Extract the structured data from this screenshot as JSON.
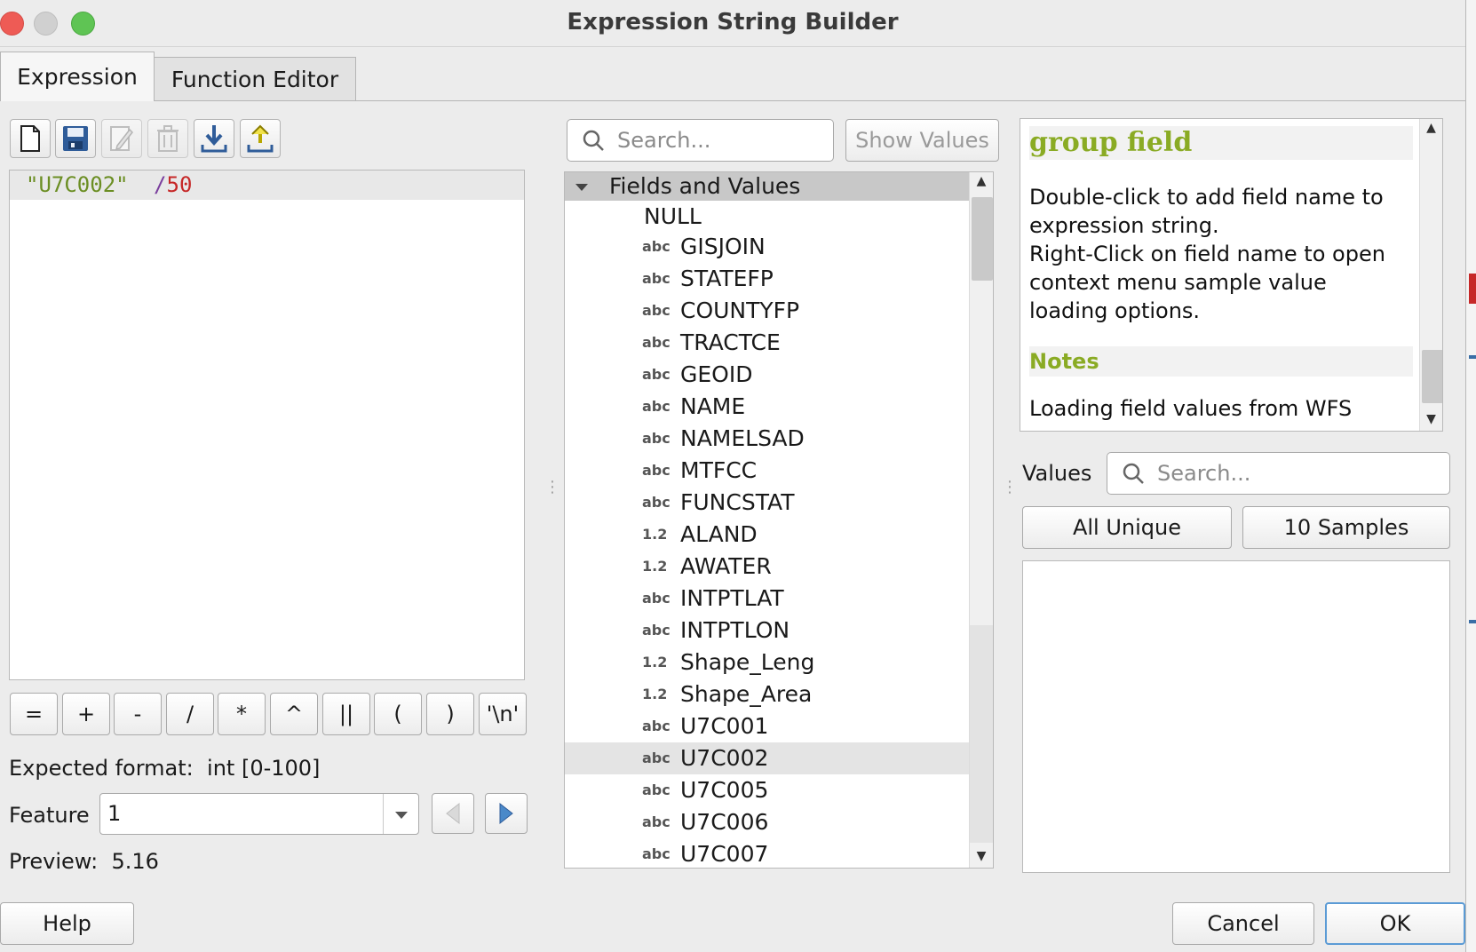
{
  "window": {
    "title": "Expression String Builder"
  },
  "tabs": [
    {
      "label": "Expression",
      "active": true
    },
    {
      "label": "Function Editor",
      "active": false
    }
  ],
  "toolbar": {
    "icons": [
      "new-file-icon",
      "save-icon",
      "edit-icon",
      "delete-icon",
      "import-icon",
      "export-icon"
    ]
  },
  "editor": {
    "field_token": "\"U7C002\"",
    "operator": "/",
    "number": "50",
    "colors": {
      "string": "#6b8e23",
      "operator": "#7a3e9d",
      "number": "#c62828"
    }
  },
  "operators": [
    "=",
    "+",
    "-",
    "/",
    "*",
    "^",
    "||",
    "(",
    ")",
    "'\\n'"
  ],
  "expected_format": {
    "label": "Expected format:",
    "value": "int [0-100]"
  },
  "feature": {
    "label": "Feature",
    "value": "1"
  },
  "preview": {
    "label": "Preview:",
    "value": "5.16"
  },
  "search": {
    "placeholder": "Search...",
    "show_values_label": "Show Values"
  },
  "tree": {
    "group_label": "Fields and Values",
    "items": [
      {
        "type": "",
        "name": "NULL"
      },
      {
        "type": "abc",
        "name": "GISJOIN"
      },
      {
        "type": "abc",
        "name": "STATEFP"
      },
      {
        "type": "abc",
        "name": "COUNTYFP"
      },
      {
        "type": "abc",
        "name": "TRACTCE"
      },
      {
        "type": "abc",
        "name": "GEOID"
      },
      {
        "type": "abc",
        "name": "NAME"
      },
      {
        "type": "abc",
        "name": "NAMELSAD"
      },
      {
        "type": "abc",
        "name": "MTFCC"
      },
      {
        "type": "abc",
        "name": "FUNCSTAT"
      },
      {
        "type": "1.2",
        "name": "ALAND"
      },
      {
        "type": "1.2",
        "name": "AWATER"
      },
      {
        "type": "abc",
        "name": "INTPTLAT"
      },
      {
        "type": "abc",
        "name": "INTPTLON"
      },
      {
        "type": "1.2",
        "name": "Shape_Leng"
      },
      {
        "type": "1.2",
        "name": "Shape_Area"
      },
      {
        "type": "abc",
        "name": "U7C001"
      },
      {
        "type": "abc",
        "name": "U7C002"
      },
      {
        "type": "abc",
        "name": "U7C005"
      },
      {
        "type": "abc",
        "name": "U7C006"
      },
      {
        "type": "abc",
        "name": "U7C007"
      }
    ],
    "selected_name": "U7C002"
  },
  "help": {
    "title": "group field",
    "line1": "Double-click to add field name to",
    "line2": "expression string.",
    "line3": "Right-Click on field name to open",
    "line4": "context menu sample value",
    "line5": "loading options.",
    "notes_title": "Notes",
    "notes_text": "Loading field values from WFS"
  },
  "values": {
    "label": "Values",
    "search_placeholder": "Search...",
    "all_unique_label": "All Unique",
    "samples_label": "10 Samples"
  },
  "buttons": {
    "help": "Help",
    "cancel": "Cancel",
    "ok": "OK"
  }
}
